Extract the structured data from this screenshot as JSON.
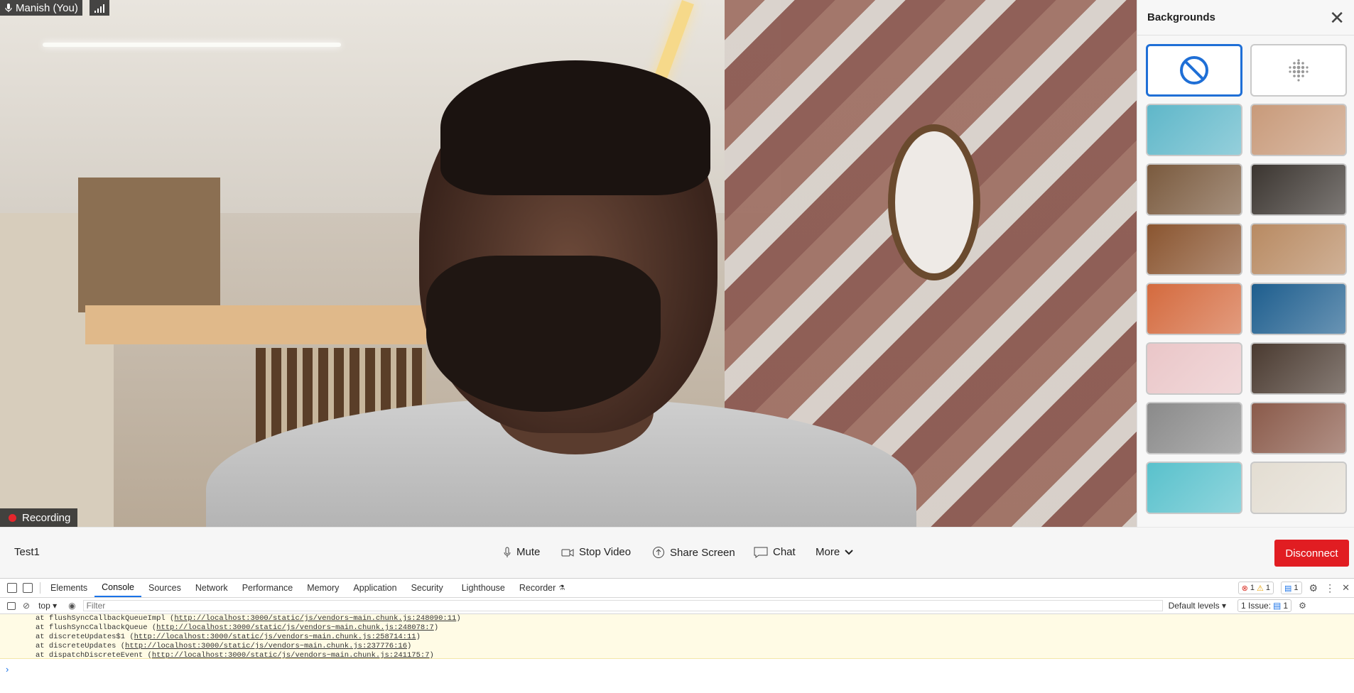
{
  "video": {
    "participant_name": "Manish (You)",
    "recording_label": "Recording"
  },
  "backgrounds_panel": {
    "title": "Backgrounds",
    "tiles": [
      {
        "name": "none",
        "color": "#ffffff"
      },
      {
        "name": "blur",
        "color": "#ffffff"
      },
      {
        "name": "paint-splash",
        "color": "#5fb7c9"
      },
      {
        "name": "living-room",
        "color": "#c89a7a"
      },
      {
        "name": "bookshelf",
        "color": "#7a5a3e"
      },
      {
        "name": "cafe",
        "color": "#3b3530"
      },
      {
        "name": "lounge-orange",
        "color": "#8a5530"
      },
      {
        "name": "lounge-beige",
        "color": "#b88a62"
      },
      {
        "name": "desert",
        "color": "#d46a3e"
      },
      {
        "name": "ocean",
        "color": "#1e5e8e"
      },
      {
        "name": "flowers",
        "color": "#eac6c8"
      },
      {
        "name": "kitchen",
        "color": "#4a3a30"
      },
      {
        "name": "modern-room",
        "color": "#8a8a8a"
      },
      {
        "name": "canyon",
        "color": "#8a5a4a"
      },
      {
        "name": "beach",
        "color": "#59c1cc"
      },
      {
        "name": "dining",
        "color": "#e3ddd2"
      }
    ]
  },
  "controls": {
    "meeting_name": "Test1",
    "mute": "Mute",
    "stop_video": "Stop Video",
    "share_screen": "Share Screen",
    "chat": "Chat",
    "more": "More",
    "disconnect": "Disconnect"
  },
  "devtools": {
    "tabs": [
      "Elements",
      "Console",
      "Sources",
      "Network",
      "Performance",
      "Memory",
      "Application",
      "Security",
      "Lighthouse",
      "Recorder"
    ],
    "active_tab": "Console",
    "error_count": "1",
    "warning_count": "1",
    "message_count": "1",
    "context": "top",
    "filter_placeholder": "Filter",
    "levels": "Default levels",
    "issues": "1 Issue:",
    "issues_count": "1",
    "log_lines": [
      {
        "prefix": "at flushSyncCallbackQueueImpl (",
        "link": "http://localhost:3000/static/js/vendors~main.chunk.js:248090:11",
        "suffix": ")"
      },
      {
        "prefix": "at flushSyncCallbackQueue (",
        "link": "http://localhost:3000/static/js/vendors~main.chunk.js:248078:7",
        "suffix": ")"
      },
      {
        "prefix": "at discreteUpdates$1 (",
        "link": "http://localhost:3000/static/js/vendors~main.chunk.js:258714:11",
        "suffix": ")"
      },
      {
        "prefix": "at discreteUpdates (",
        "link": "http://localhost:3000/static/js/vendors~main.chunk.js:237776:16",
        "suffix": ")"
      },
      {
        "prefix": "at dispatchDiscreteEvent (",
        "link": "http://localhost:3000/static/js/vendors~main.chunk.js:241175:7",
        "suffix": ")"
      }
    ],
    "prompt_glyph": "›"
  }
}
